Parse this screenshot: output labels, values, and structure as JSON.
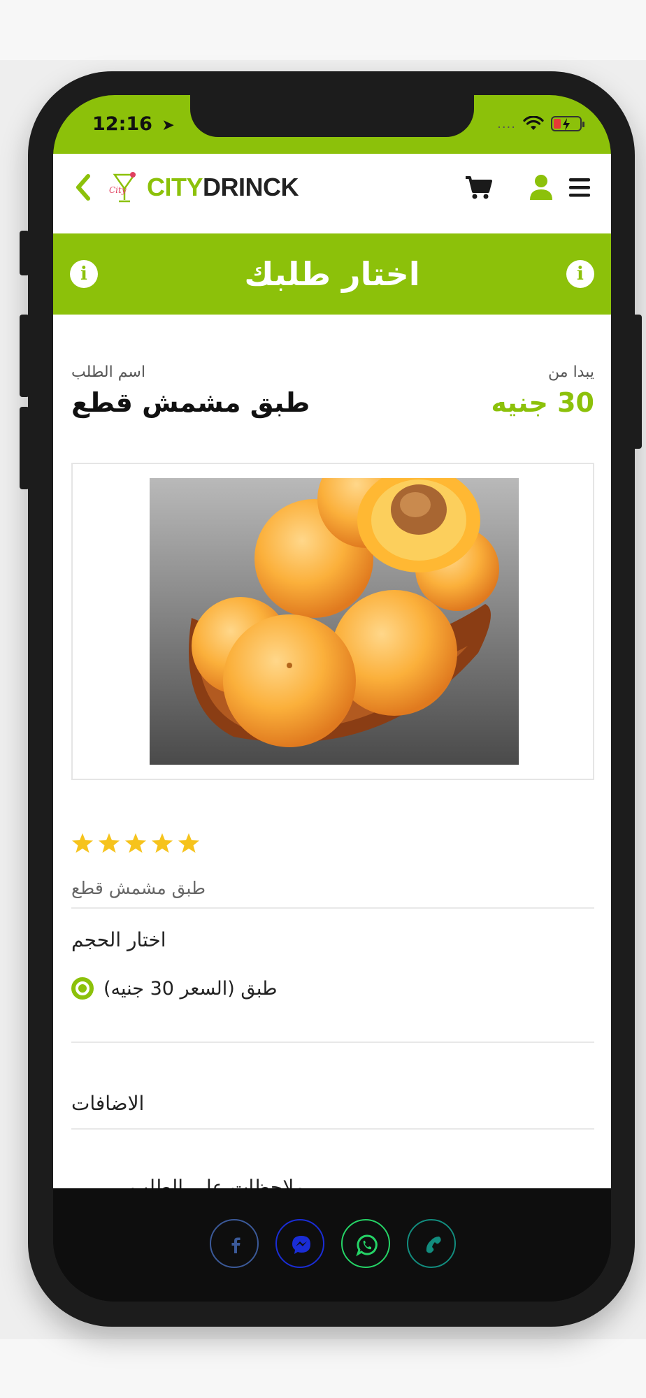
{
  "status_bar": {
    "time": "12:16",
    "location_icon": "location-arrow-icon",
    "signal_dots": "....",
    "wifi_icon": "wifi-icon",
    "battery_icon": "battery-charging-icon",
    "battery_color": "#e53935"
  },
  "colors": {
    "brand_green": "#8cc10a",
    "text_dark": "#111111",
    "text_muted": "#666666"
  },
  "navbar": {
    "back_icon": "chevron-left-icon",
    "logo_part1": "CITY",
    "logo_part2": "DRINCK",
    "cart_icon": "cart-icon",
    "user_icon": "user-icon",
    "menu_icon": "hamburger-menu-icon"
  },
  "title_bar": {
    "title": "اختار طلبك",
    "info_icon": "info-icon"
  },
  "product": {
    "name_label": "اسم الطلب",
    "name": "طبق مشمش قطع",
    "price_label": "يبدا من",
    "price": "30 جنيه",
    "rating": 5,
    "rating_max": 5,
    "description": "طبق مشمش قطع"
  },
  "size": {
    "title": "اختار الحجم",
    "options": [
      {
        "label": "طبق (السعر 30 جنيه)",
        "selected": true
      }
    ]
  },
  "addons": {
    "title": "الاضافات"
  },
  "next_section_partial": "ملاحظات على الطلب",
  "social": [
    {
      "name": "facebook",
      "icon": "facebook-icon",
      "color": "#3b5998"
    },
    {
      "name": "messenger",
      "icon": "messenger-icon",
      "color": "#1a2dd6"
    },
    {
      "name": "whatsapp",
      "icon": "whatsapp-icon",
      "color": "#25d366"
    },
    {
      "name": "phone",
      "icon": "phone-icon",
      "color": "#128c7e"
    }
  ]
}
